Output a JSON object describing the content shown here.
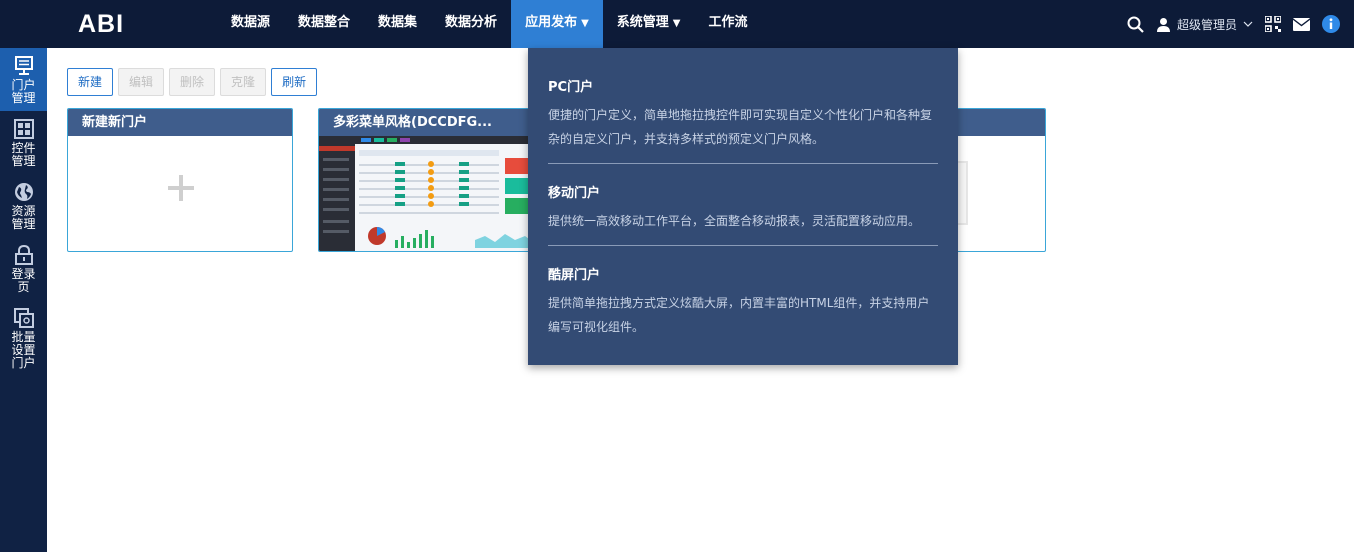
{
  "header": {
    "logo": "ABI",
    "nav": [
      {
        "label": "数据源",
        "active": false,
        "dropdown": false
      },
      {
        "label": "数据整合",
        "active": false,
        "dropdown": false
      },
      {
        "label": "数据集",
        "active": false,
        "dropdown": false
      },
      {
        "label": "数据分析",
        "active": false,
        "dropdown": false
      },
      {
        "label": "应用发布",
        "active": true,
        "dropdown": true
      },
      {
        "label": "系统管理",
        "active": false,
        "dropdown": true
      },
      {
        "label": "工作流",
        "active": false,
        "dropdown": false
      }
    ],
    "user": "超级管理员"
  },
  "sidebar": {
    "items": [
      {
        "label": "门户管理",
        "icon": "monitor-icon",
        "active": true
      },
      {
        "label": "控件管理",
        "icon": "grid-icon",
        "active": false
      },
      {
        "label": "资源管理",
        "icon": "globe-icon",
        "active": false
      },
      {
        "label": "登录页",
        "icon": "lock-icon",
        "active": false
      },
      {
        "label": "批量设置门户",
        "icon": "copy-icon",
        "active": false
      }
    ]
  },
  "toolbar": {
    "new_label": "新建",
    "edit_label": "编辑",
    "delete_label": "删除",
    "clone_label": "克隆",
    "refresh_label": "刷新"
  },
  "cards": [
    {
      "title": "新建新门户"
    },
    {
      "title": "多彩菜单风格(DCCDFG..."
    }
  ],
  "dropdown": {
    "items": [
      {
        "title": "PC门户",
        "desc": "便捷的门户定义，简单地拖拉拽控件即可实现自定义个性化门户和各种复杂的自定义门户，并支持多样式的预定义门户风格。"
      },
      {
        "title": "移动门户",
        "desc": "提供统一高效移动工作平台，全面整合移动报表，灵活配置移动应用。"
      },
      {
        "title": "酷屏门户",
        "desc": "提供简单拖拉拽方式定义炫酷大屏，内置丰富的HTML组件，并支持用户编写可视化组件。"
      }
    ]
  },
  "colors": {
    "topbar": "#0d1b38",
    "nav_active": "#2f7fd4",
    "sidebar": "#102244",
    "sidebar_active": "#1d5fae",
    "card_header": "#3f5d8c",
    "dropdown_bg": "#334b74"
  }
}
